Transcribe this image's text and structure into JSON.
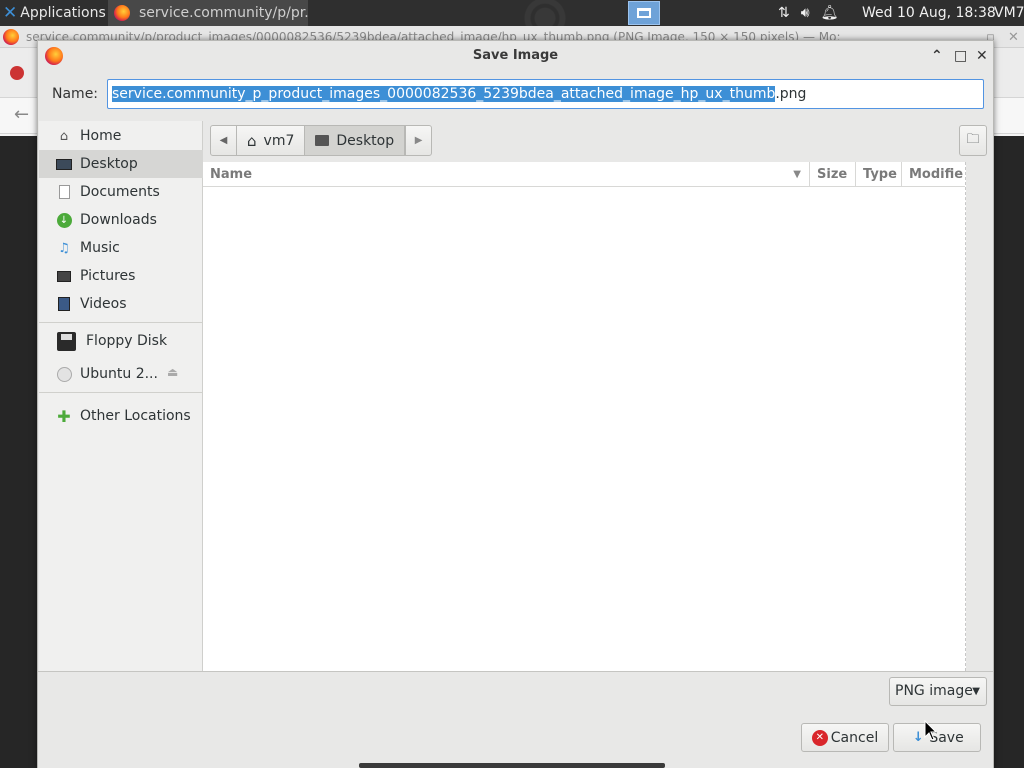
{
  "panel": {
    "applications_label": "Applications",
    "task_label": "service.community/p/pr...",
    "clock": "Wed 10 Aug, 18:38",
    "user": "VM7"
  },
  "background_window": {
    "title": "service.community/p/product_images/0000082536/5239bdea/attached_image/hp_ux_thumb.png (PNG Image, 150 × 150 pixels) — Mo:"
  },
  "dialog": {
    "title": "Save Image",
    "name_label": "Name:",
    "filename_selected": "service.community_p_product_images_0000082536_5239bdea_attached_image_hp_ux_thumb",
    "filename_ext": ".png"
  },
  "sidebar": {
    "places": [
      {
        "label": "Home",
        "icon": "home-icon"
      },
      {
        "label": "Desktop",
        "icon": "desktop-icon"
      },
      {
        "label": "Documents",
        "icon": "documents-icon"
      },
      {
        "label": "Downloads",
        "icon": "downloads-icon"
      },
      {
        "label": "Music",
        "icon": "music-icon"
      },
      {
        "label": "Pictures",
        "icon": "pictures-icon"
      },
      {
        "label": "Videos",
        "icon": "videos-icon"
      }
    ],
    "devices": [
      {
        "label": "Floppy Disk",
        "icon": "floppy-icon"
      },
      {
        "label": "Ubuntu 2...",
        "icon": "disc-icon"
      }
    ],
    "other": {
      "label": "Other Locations",
      "icon": "plus-icon"
    },
    "active": "Desktop"
  },
  "pathbar": {
    "segments": [
      "vm7",
      "Desktop"
    ],
    "current": "Desktop"
  },
  "filelist": {
    "columns": [
      "Name",
      "Size",
      "Type",
      "Modifie"
    ]
  },
  "filetype": {
    "selected": "PNG image"
  },
  "buttons": {
    "cancel": "Cancel",
    "save": "Save"
  },
  "colors": {
    "accent": "#3d8fd6",
    "panel_bg": "#2f2f2f",
    "dialog_bg": "#e8e8e7"
  }
}
